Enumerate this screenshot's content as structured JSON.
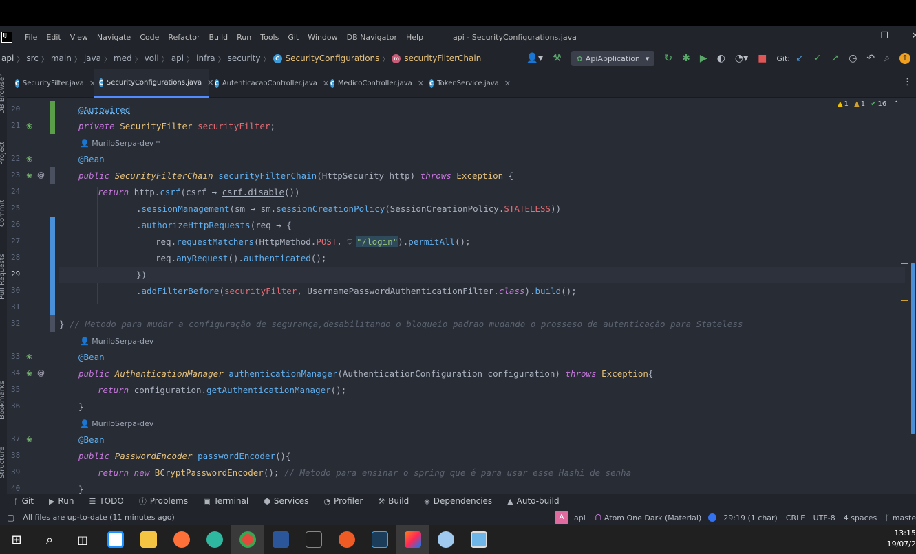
{
  "window": {
    "title": "api - SecurityConfigurations.java",
    "menu": [
      "File",
      "Edit",
      "View",
      "Navigate",
      "Code",
      "Refactor",
      "Build",
      "Run",
      "Tools",
      "Git",
      "Window",
      "DB Navigator",
      "Help"
    ],
    "logo": "IJ"
  },
  "breadcrumb": {
    "items": [
      "api",
      "src",
      "main",
      "java",
      "med",
      "voll",
      "api",
      "infra",
      "security"
    ],
    "class_name": "SecurityConfigurations",
    "method_name": "securityFilterChain"
  },
  "toolbar": {
    "run_config": "ApiApplication",
    "git_label": "Git:"
  },
  "tabs": [
    {
      "label": "SecurityFilter.java",
      "active": false
    },
    {
      "label": "SecurityConfigurations.java",
      "active": true
    },
    {
      "label": "AutenticacaoController.java",
      "active": false
    },
    {
      "label": "MedicoController.java",
      "active": false
    },
    {
      "label": "TokenService.java",
      "active": false
    }
  ],
  "side_tools": [
    "DB Browser",
    "Project",
    "Commit",
    "Pull Requests",
    "Bookmarks",
    "Structure"
  ],
  "inspections": {
    "warn1": "1",
    "warn2": "1",
    "ok": "16"
  },
  "editor": {
    "current_line": "29",
    "line_numbers": [
      "20",
      "21",
      "",
      "22",
      "23",
      "24",
      "25",
      "26",
      "27",
      "28",
      "29",
      "30",
      "31",
      "32",
      "",
      "33",
      "34",
      "35",
      "36",
      "",
      "37",
      "38",
      "39",
      "40"
    ],
    "author_hints": [
      "MuriloSerpa-dev *",
      "MuriloSerpa-dev",
      "MuriloSerpa-dev"
    ],
    "lines": {
      "l20": "@Autowired",
      "l21a": "private ",
      "l21b": "SecurityFilter ",
      "l21c": "securityFilter",
      "l21d": ";",
      "l22": "@Bean",
      "l23a": "public ",
      "l23b": "SecurityFilterChain ",
      "l23c": "securityFilterChain",
      "l23d": "(HttpSecurity http) ",
      "l23e": "throws ",
      "l23f": "Exception",
      "l23g": " {",
      "l24a": "return ",
      "l24b": "http.",
      "l24c": "csrf",
      "l24d": "(csrf → ",
      "l24e": "csrf.disable",
      "l24f": "())",
      "l25a": ".",
      "l25b": "sessionManagement",
      "l25c": "(sm → sm.",
      "l25d": "sessionCreationPolicy",
      "l25e": "(SessionCreationPolicy.",
      "l25f": "STATELESS",
      "l25g": "))",
      "l26a": ".",
      "l26b": "authorizeHttpRequests",
      "l26c": "(req → {",
      "l27a": "req.",
      "l27b": "requestMatchers",
      "l27c": "(HttpMethod.",
      "l27d": "POST",
      "l27e": ", ",
      "l27f": "\"/login\"",
      "l27g": ").",
      "l27h": "permitAll",
      "l27i": "();",
      "l28a": "req.",
      "l28b": "anyRequest",
      "l28c": "().",
      "l28d": "authenticated",
      "l28e": "();",
      "l29": "})",
      "l30a": ".",
      "l30b": "addFilterBefore",
      "l30c": "(",
      "l30d": "securityFilter",
      "l30e": ", UsernamePasswordAuthenticationFilter.",
      "l30f": "class",
      "l30g": ").",
      "l30h": "build",
      "l30i": "();",
      "l32a": "} ",
      "l32b": "// Metodo para mudar a configuração de segurança,desabilitando o bloqueio padrao mudando o prosseso de autenticação para Stateless",
      "l33": "@Bean",
      "l34a": "public ",
      "l34b": "AuthenticationManager ",
      "l34c": "authenticationManager",
      "l34d": "(AuthenticationConfiguration configuration) ",
      "l34e": "throws ",
      "l34f": "Exception",
      "l34g": "{",
      "l35a": "return ",
      "l35b": "configuration.",
      "l35c": "getAuthenticationManager",
      "l35d": "();",
      "l36": "}",
      "l37": "@Bean",
      "l38a": "public ",
      "l38b": "PasswordEncoder ",
      "l38c": "passwordEncoder",
      "l38d": "(){",
      "l39a": "return new ",
      "l39b": "BCryptPasswordEncoder",
      "l39c": "(); ",
      "l39d": "// Metodo para ensinar o spring que é para usar esse Hashi de senha",
      "l40": "}"
    }
  },
  "bottom_tools": [
    "Git",
    "Run",
    "TODO",
    "Problems",
    "Terminal",
    "Services",
    "Profiler",
    "Build",
    "Dependencies",
    "Auto-build"
  ],
  "status": {
    "message": "All files are up-to-date (11 minutes ago)",
    "project": "api",
    "project_badge": "A",
    "theme": "Atom One Dark (Material)",
    "position": "29:19 (1 char)",
    "line_sep": "CRLF",
    "encoding": "UTF-8",
    "indent": "4 spaces",
    "branch": "master"
  },
  "taskbar": {
    "apps": [
      "start",
      "search",
      "task-view",
      "store",
      "explorer",
      "firefox",
      "edge",
      "chrome",
      "word",
      "terminal",
      "postman",
      "vscode",
      "intellij",
      "paint",
      "photos"
    ],
    "time": "13:15",
    "date": "19/07/2"
  },
  "colors": {
    "accent": "#528bff",
    "bg": "#282c34",
    "chrome": "#21252b",
    "vcs_added": "#5a9e4a",
    "vcs_modified": "#4a90d9"
  }
}
